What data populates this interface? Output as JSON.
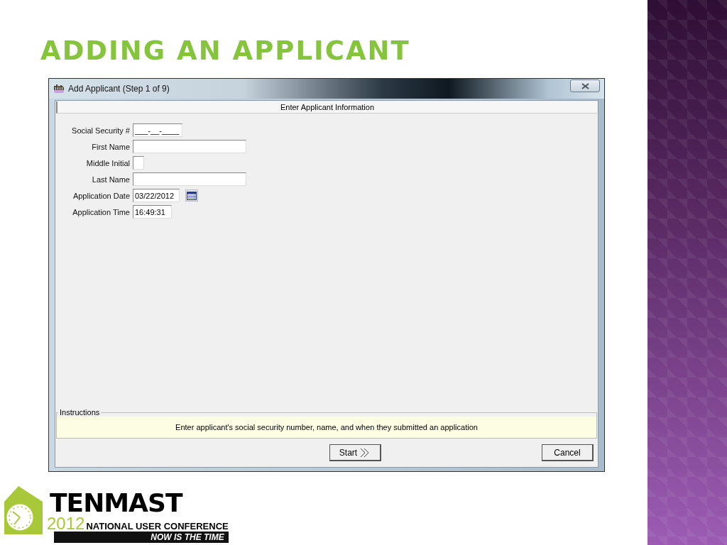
{
  "slide": {
    "title": "ADDING AN APPLICANT"
  },
  "window": {
    "title": "Add Applicant (Step 1 of 9)",
    "header": "Enter Applicant Information",
    "fields": [
      {
        "label": "Social Security #",
        "value": "___-__-____",
        "kind": "ssn"
      },
      {
        "label": "First Name",
        "kind": "name"
      },
      {
        "label": "Middle Initial",
        "kind": "initial"
      },
      {
        "label": "Last Name",
        "kind": "name"
      },
      {
        "label": "Application Date",
        "value": "03/22/2012",
        "kind": "date"
      },
      {
        "label": "Application Time",
        "value": "16:49:31",
        "kind": "time"
      }
    ],
    "instructions": {
      "legend": "Instructions",
      "text": "Enter applicant's social security number, name, and when they submitted an application"
    },
    "buttons": [
      {
        "label": "Start",
        "kind": "next"
      },
      {
        "label": "Cancel",
        "kind": "cancel"
      }
    ]
  },
  "logo": {
    "name": "TENMAST",
    "year": "2012",
    "subtitle": "NATIONAL USER CONFERENCE",
    "tagline": "NOW IS THE TIME"
  }
}
